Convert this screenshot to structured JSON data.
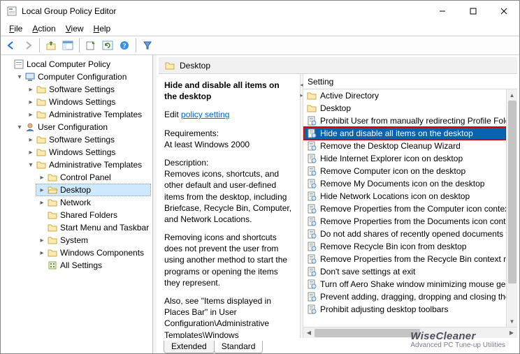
{
  "window": {
    "title": "Local Group Policy Editor"
  },
  "menu": {
    "file": "File",
    "action": "Action",
    "view": "View",
    "help": "Help"
  },
  "tree": {
    "root": "Local Computer Policy",
    "cc": "Computer Configuration",
    "cc_sw": "Software Settings",
    "cc_win": "Windows Settings",
    "cc_adm": "Administrative Templates",
    "uc": "User Configuration",
    "uc_sw": "Software Settings",
    "uc_win": "Windows Settings",
    "uc_adm": "Administrative Templates",
    "cp": "Control Panel",
    "desktop_node": "Desktop",
    "network": "Network",
    "shared": "Shared Folders",
    "start": "Start Menu and Taskbar",
    "system": "System",
    "wincomp": "Windows Components",
    "allset": "All Settings"
  },
  "breadcrumb": {
    "label": "Desktop"
  },
  "desc": {
    "title": "Hide and disable all items on the desktop",
    "edit_prefix": "Edit ",
    "edit_link": "policy setting ",
    "req_label": "Requirements:",
    "req_text": "At least Windows 2000",
    "d_label": "Description:",
    "d_p1": "Removes icons, shortcuts, and other default and user-defined items from the desktop, including Briefcase, Recycle Bin, Computer, and Network Locations.",
    "d_p2": "Removing icons and shortcuts does not prevent the user from using another method to start the programs or opening the items they represent.",
    "d_p3": "Also, see \"Items displayed in Places Bar\" in User Configuration\\Administrative Templates\\Windows"
  },
  "list": {
    "header": "Setting",
    "items": [
      {
        "type": "folder",
        "label": "Active Directory"
      },
      {
        "type": "folder",
        "label": "Desktop"
      },
      {
        "type": "policy",
        "label": "Prohibit User from manually redirecting Profile Folde"
      },
      {
        "type": "policy",
        "label": "Hide and disable all items on the desktop",
        "selected": true,
        "highlight": true
      },
      {
        "type": "policy",
        "label": "Remove the Desktop Cleanup Wizard"
      },
      {
        "type": "policy",
        "label": "Hide Internet Explorer icon on desktop"
      },
      {
        "type": "policy",
        "label": "Remove Computer icon on the desktop"
      },
      {
        "type": "policy",
        "label": "Remove My Documents icon on the desktop"
      },
      {
        "type": "policy",
        "label": "Hide Network Locations icon on desktop"
      },
      {
        "type": "policy",
        "label": "Remove Properties from the Computer icon context"
      },
      {
        "type": "policy",
        "label": "Remove Properties from the Documents icon context"
      },
      {
        "type": "policy",
        "label": "Do not add shares of recently opened documents to"
      },
      {
        "type": "policy",
        "label": "Remove Recycle Bin icon from desktop"
      },
      {
        "type": "policy",
        "label": "Remove Properties from the Recycle Bin context me"
      },
      {
        "type": "policy",
        "label": "Don't save settings at exit"
      },
      {
        "type": "policy",
        "label": "Turn off Aero Shake window minimizing mouse gest"
      },
      {
        "type": "policy",
        "label": "Prevent adding, dragging, dropping and closing the"
      },
      {
        "type": "policy",
        "label": "Prohibit adjusting desktop toolbars"
      }
    ]
  },
  "tabs": {
    "extended": "Extended",
    "standard": "Standard"
  },
  "watermark": {
    "brand": "WiseCleaner",
    "tag": "Advanced PC Tune-up Utilities"
  }
}
